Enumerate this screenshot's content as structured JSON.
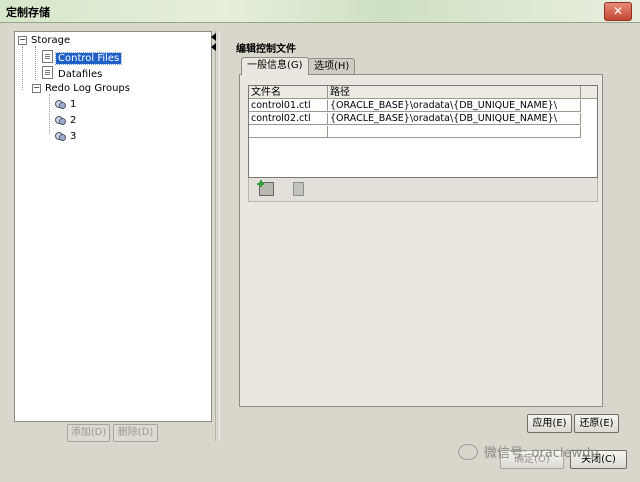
{
  "window": {
    "title": "定制存储",
    "close_glyph": "✕"
  },
  "tree": {
    "root": {
      "label": "Storage",
      "expander": "−"
    },
    "items": [
      {
        "label": "Control Files"
      },
      {
        "label": "Datafiles"
      },
      {
        "label": "Redo Log Groups",
        "expander": "−"
      },
      {
        "label": "1"
      },
      {
        "label": "2"
      },
      {
        "label": "3"
      }
    ]
  },
  "left_buttons": {
    "add": "添加(D)",
    "delete": "删除(D)"
  },
  "panel": {
    "title": "编辑控制文件",
    "tabs": [
      {
        "label": "一般信息(G)"
      },
      {
        "label": "选项(H)"
      }
    ],
    "table": {
      "columns": [
        "文件名",
        "路径"
      ],
      "rows": [
        [
          "control01.ctl",
          "{ORACLE_BASE}\\oradata\\{DB_UNIQUE_NAME}\\"
        ],
        [
          "control02.ctl",
          "{ORACLE_BASE}\\oradata\\{DB_UNIQUE_NAME}\\"
        ]
      ]
    },
    "apply": "应用(E)",
    "revert": "还原(E)"
  },
  "bottom_buttons": {
    "ok": "确定(O)",
    "close": "关闭(C)"
  },
  "watermark": "微信号: oraclewdp",
  "icons": [
    "close-icon",
    "expander-icon",
    "control-file-icon",
    "datafile-icon",
    "redo-log-group-icon",
    "add-row-icon",
    "trash-icon",
    "collapse-arrow-icon",
    "wechat-icon"
  ]
}
